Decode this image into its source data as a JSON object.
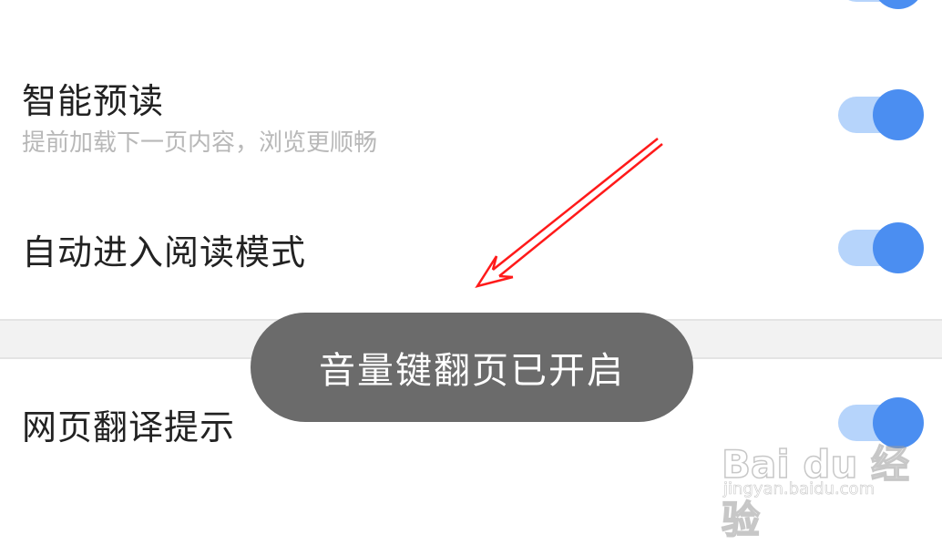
{
  "settings": {
    "top_partial": {
      "toggle_on": true
    },
    "smart_preread": {
      "title": "智能预读",
      "subtitle": "提前加载下一页内容，浏览更顺畅",
      "toggle_on": true
    },
    "auto_reading_mode": {
      "title": "自动进入阅读模式",
      "toggle_on": true
    },
    "web_translate_hint": {
      "title": "网页翻译提示",
      "toggle_on": true
    }
  },
  "toast": {
    "message": "音量键翻页已开启"
  },
  "annotation": {
    "arrow_color": "#ff1a1a"
  },
  "watermark": {
    "brand": "Bai du 经验",
    "url": "jingyan.baidu.com"
  },
  "colors": {
    "toggle_knob": "#4b8ef1",
    "toggle_track": "#b6d4fb",
    "toast_bg": "#6b6b6b",
    "section_divider": "#f2f2f2"
  }
}
